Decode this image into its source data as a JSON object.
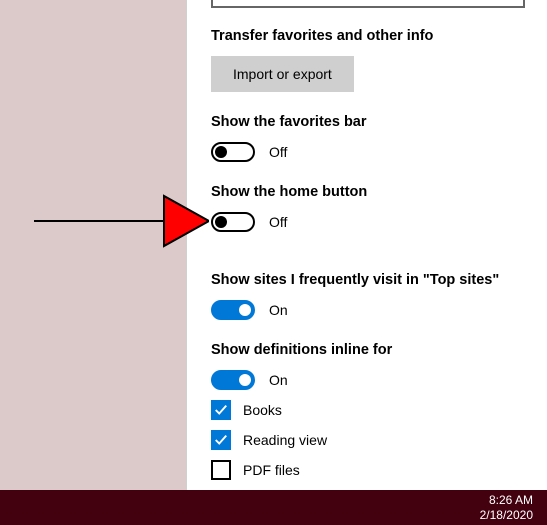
{
  "settings": {
    "transfer": {
      "heading": "Transfer favorites and other info",
      "button": "Import or export"
    },
    "favorites_bar": {
      "heading": "Show the favorites bar",
      "state": "Off"
    },
    "home_button": {
      "heading": "Show the home button",
      "state": "Off"
    },
    "top_sites": {
      "heading": "Show sites I frequently visit in \"Top sites\"",
      "state": "On"
    },
    "definitions": {
      "heading": "Show definitions inline for",
      "state": "On",
      "items": [
        {
          "label": "Books",
          "checked": true
        },
        {
          "label": "Reading view",
          "checked": true
        },
        {
          "label": "PDF files",
          "checked": false
        }
      ]
    }
  },
  "taskbar": {
    "time": "8:26 AM",
    "date": "2/18/2020"
  }
}
